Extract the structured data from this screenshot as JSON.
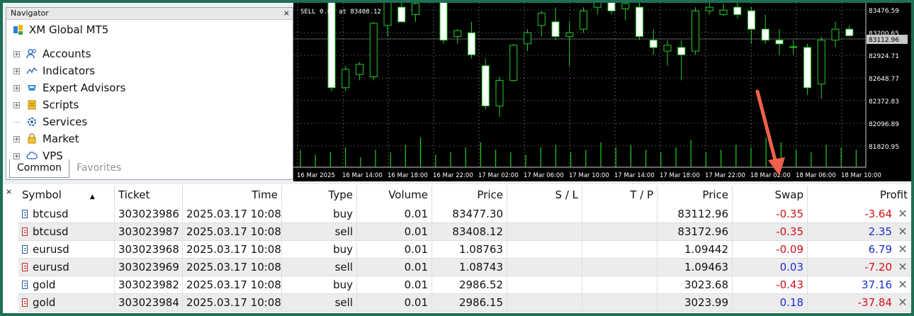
{
  "navigator": {
    "title": "Navigator",
    "close_label": "×",
    "root_label": "XM Global MT5",
    "items": [
      {
        "label": "Accounts",
        "icon": "accounts-icon"
      },
      {
        "label": "Indicators",
        "icon": "indicators-icon"
      },
      {
        "label": "Expert Advisors",
        "icon": "expert-advisors-icon"
      },
      {
        "label": "Scripts",
        "icon": "scripts-icon"
      },
      {
        "label": "Services",
        "icon": "services-icon"
      },
      {
        "label": "Market",
        "icon": "market-icon"
      },
      {
        "label": "VPS",
        "icon": "vps-icon"
      }
    ],
    "tabs": {
      "common": "Common",
      "favorites": "Favorites"
    }
  },
  "chart": {
    "top_label_line2": "SELL 0.01 at 83408.12",
    "current_price": "83112.96",
    "price_labels": [
      "83476.59",
      "83200.65",
      "82924.71",
      "82648.77",
      "82372.83",
      "82096.89",
      "81820.95"
    ],
    "time_labels": [
      "16 Mar 2025",
      "16 Mar 14:00",
      "16 Mar 18:00",
      "16 Mar 22:00",
      "17 Mar 02:00",
      "17 Mar 06:00",
      "17 Mar 10:00",
      "17 Mar 14:00",
      "17 Mar 18:00",
      "17 Mar 22:00",
      "18 Mar 02:00",
      "18 Mar 06:00",
      "18 Mar 10:00"
    ],
    "candles": [
      {
        "o": 83800,
        "h": 84000,
        "l": 82350,
        "c": 82400
      },
      {
        "o": 82400,
        "h": 82700,
        "l": 82350,
        "c": 82650
      },
      {
        "o": 82580,
        "h": 82750,
        "l": 82500,
        "c": 82720
      },
      {
        "o": 82550,
        "h": 83300,
        "l": 82500,
        "c": 83280
      },
      {
        "o": 83250,
        "h": 83700,
        "l": 83100,
        "c": 83650
      },
      {
        "o": 83500,
        "h": 83800,
        "l": 83300,
        "c": 83300
      },
      {
        "o": 83400,
        "h": 83600,
        "l": 83300,
        "c": 83550
      },
      {
        "o": 83700,
        "h": 83800,
        "l": 83550,
        "c": 83580
      },
      {
        "o": 83600,
        "h": 83700,
        "l": 83000,
        "c": 83050
      },
      {
        "o": 83100,
        "h": 83200,
        "l": 83000,
        "c": 83180
      },
      {
        "o": 83150,
        "h": 83300,
        "l": 82800,
        "c": 82850
      },
      {
        "o": 82700,
        "h": 82800,
        "l": 82100,
        "c": 82150
      },
      {
        "o": 82150,
        "h": 82550,
        "l": 82000,
        "c": 82500
      },
      {
        "o": 82500,
        "h": 83000,
        "l": 82480,
        "c": 82980
      },
      {
        "o": 83000,
        "h": 83200,
        "l": 82900,
        "c": 83150
      },
      {
        "o": 83250,
        "h": 83450,
        "l": 83100,
        "c": 83420
      },
      {
        "o": 83300,
        "h": 83500,
        "l": 83050,
        "c": 83100
      },
      {
        "o": 83100,
        "h": 83300,
        "l": 82700,
        "c": 83150
      },
      {
        "o": 83200,
        "h": 83500,
        "l": 83150,
        "c": 83450
      },
      {
        "o": 83500,
        "h": 83700,
        "l": 83400,
        "c": 83650
      },
      {
        "o": 83600,
        "h": 83700,
        "l": 83400,
        "c": 83450
      },
      {
        "o": 83480,
        "h": 83650,
        "l": 83320,
        "c": 83550
      },
      {
        "o": 83500,
        "h": 83620,
        "l": 83050,
        "c": 83100
      },
      {
        "o": 83050,
        "h": 83200,
        "l": 82850,
        "c": 82950
      },
      {
        "o": 82900,
        "h": 83050,
        "l": 82700,
        "c": 82980
      },
      {
        "o": 82950,
        "h": 83050,
        "l": 82500,
        "c": 82850
      },
      {
        "o": 82900,
        "h": 83500,
        "l": 82850,
        "c": 83450
      },
      {
        "o": 83450,
        "h": 83600,
        "l": 83400,
        "c": 83500
      },
      {
        "o": 83400,
        "h": 83550,
        "l": 83380,
        "c": 83460
      },
      {
        "o": 83500,
        "h": 83600,
        "l": 83350,
        "c": 83400
      },
      {
        "o": 83450,
        "h": 83500,
        "l": 83000,
        "c": 83200
      },
      {
        "o": 83200,
        "h": 83400,
        "l": 83000,
        "c": 83050
      },
      {
        "o": 83050,
        "h": 83200,
        "l": 82850,
        "c": 83000
      },
      {
        "o": 82950,
        "h": 83050,
        "l": 82850,
        "c": 82960
      },
      {
        "o": 82950,
        "h": 83000,
        "l": 82300,
        "c": 82400
      },
      {
        "o": 82450,
        "h": 83100,
        "l": 82250,
        "c": 83050
      },
      {
        "o": 83050,
        "h": 83300,
        "l": 82950,
        "c": 83200
      },
      {
        "o": 83200,
        "h": 83250,
        "l": 83100,
        "c": 83110
      }
    ],
    "volumes": [
      35,
      25,
      30,
      40,
      20,
      35,
      30,
      45,
      60,
      25,
      30,
      40,
      50,
      35,
      30,
      25,
      40,
      45,
      30,
      35,
      50,
      40,
      45,
      35,
      30,
      40,
      55,
      30,
      35,
      45,
      40,
      60,
      50,
      35,
      30,
      45,
      40,
      35
    ]
  },
  "table": {
    "close_label": "×",
    "headers": {
      "symbol": "Symbol",
      "ticket": "Ticket",
      "time": "Time",
      "type": "Type",
      "volume": "Volume",
      "price": "Price",
      "sl": "S / L",
      "tp": "T / P",
      "cur_price": "Price",
      "swap": "Swap",
      "profit": "Profit"
    },
    "rows": [
      {
        "symbol": "btcusd",
        "ticket": "303023986",
        "time": "2025.03.17 10:08:...",
        "type": "buy",
        "volume": "0.01",
        "price": "83477.30",
        "cur_price": "83112.96",
        "swap": "-0.35",
        "profit": "-3.64"
      },
      {
        "symbol": "btcusd",
        "ticket": "303023987",
        "time": "2025.03.17 10:08:...",
        "type": "sell",
        "volume": "0.01",
        "price": "83408.12",
        "cur_price": "83172.96",
        "swap": "-0.35",
        "profit": "2.35"
      },
      {
        "symbol": "eurusd",
        "ticket": "303023968",
        "time": "2025.03.17 10:08:...",
        "type": "buy",
        "volume": "0.01",
        "price": "1.08763",
        "cur_price": "1.09442",
        "swap": "-0.09",
        "profit": "6.79"
      },
      {
        "symbol": "eurusd",
        "ticket": "303023969",
        "time": "2025.03.17 10:08:...",
        "type": "sell",
        "volume": "0.01",
        "price": "1.08743",
        "cur_price": "1.09463",
        "swap": "0.03",
        "profit": "-7.20"
      },
      {
        "symbol": "gold",
        "ticket": "303023982",
        "time": "2025.03.17 10:08:...",
        "type": "buy",
        "volume": "0.01",
        "price": "2986.52",
        "cur_price": "3023.68",
        "swap": "-0.43",
        "profit": "37.16"
      },
      {
        "symbol": "gold",
        "ticket": "303023984",
        "time": "2025.03.17 10:08:...",
        "type": "sell",
        "volume": "0.01",
        "price": "2986.15",
        "cur_price": "3023.99",
        "swap": "0.18",
        "profit": "-37.84"
      }
    ]
  },
  "colors": {
    "frame": "#1f6e56",
    "buy_icon": "#2457a8",
    "sell_icon": "#c62828",
    "negative": "#d1101a",
    "positive": "#1a2ecf",
    "candle": "#22cc22",
    "annotation_arrow": "#f0604a"
  }
}
